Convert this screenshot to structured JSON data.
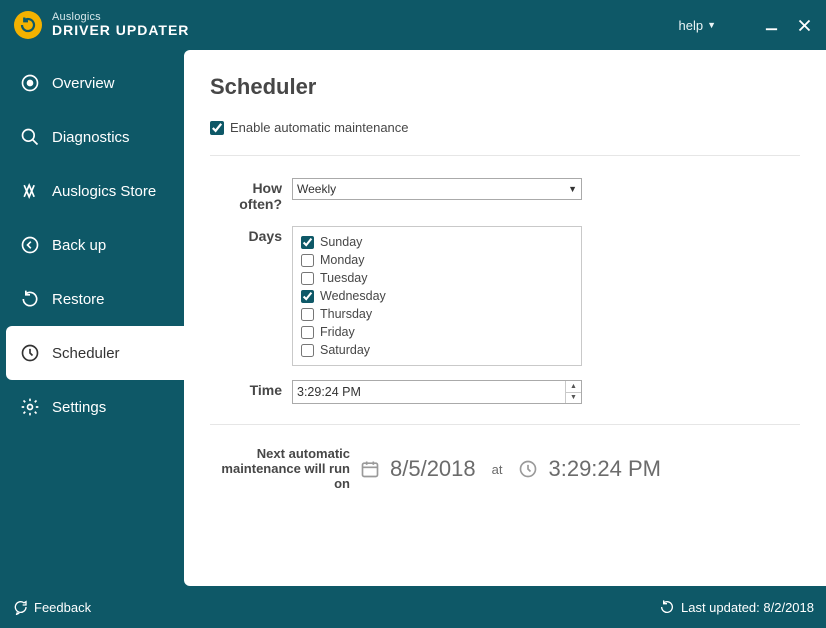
{
  "header": {
    "brand": "Auslogics",
    "title": "DRIVER UPDATER",
    "help_label": "help"
  },
  "sidebar": {
    "items": [
      {
        "label": "Overview"
      },
      {
        "label": "Diagnostics"
      },
      {
        "label": "Auslogics Store"
      },
      {
        "label": "Back up"
      },
      {
        "label": "Restore"
      },
      {
        "label": "Scheduler"
      },
      {
        "label": "Settings"
      }
    ]
  },
  "main": {
    "page_title": "Scheduler",
    "enable_label": "Enable automatic maintenance",
    "enable_checked": true,
    "how_often_label": "How often?",
    "how_often_value": "Weekly",
    "days_label": "Days",
    "days": [
      {
        "label": "Sunday",
        "checked": true
      },
      {
        "label": "Monday",
        "checked": false
      },
      {
        "label": "Tuesday",
        "checked": false
      },
      {
        "label": "Wednesday",
        "checked": true
      },
      {
        "label": "Thursday",
        "checked": false
      },
      {
        "label": "Friday",
        "checked": false
      },
      {
        "label": "Saturday",
        "checked": false
      }
    ],
    "time_label": "Time",
    "time_value": "3:29:24 PM",
    "next_label_line1": "Next automatic",
    "next_label_line2": "maintenance will run on",
    "next_date": "8/5/2018",
    "next_at": "at",
    "next_time": "3:29:24 PM"
  },
  "statusbar": {
    "feedback_label": "Feedback",
    "last_updated_label": "Last updated: 8/2/2018"
  }
}
